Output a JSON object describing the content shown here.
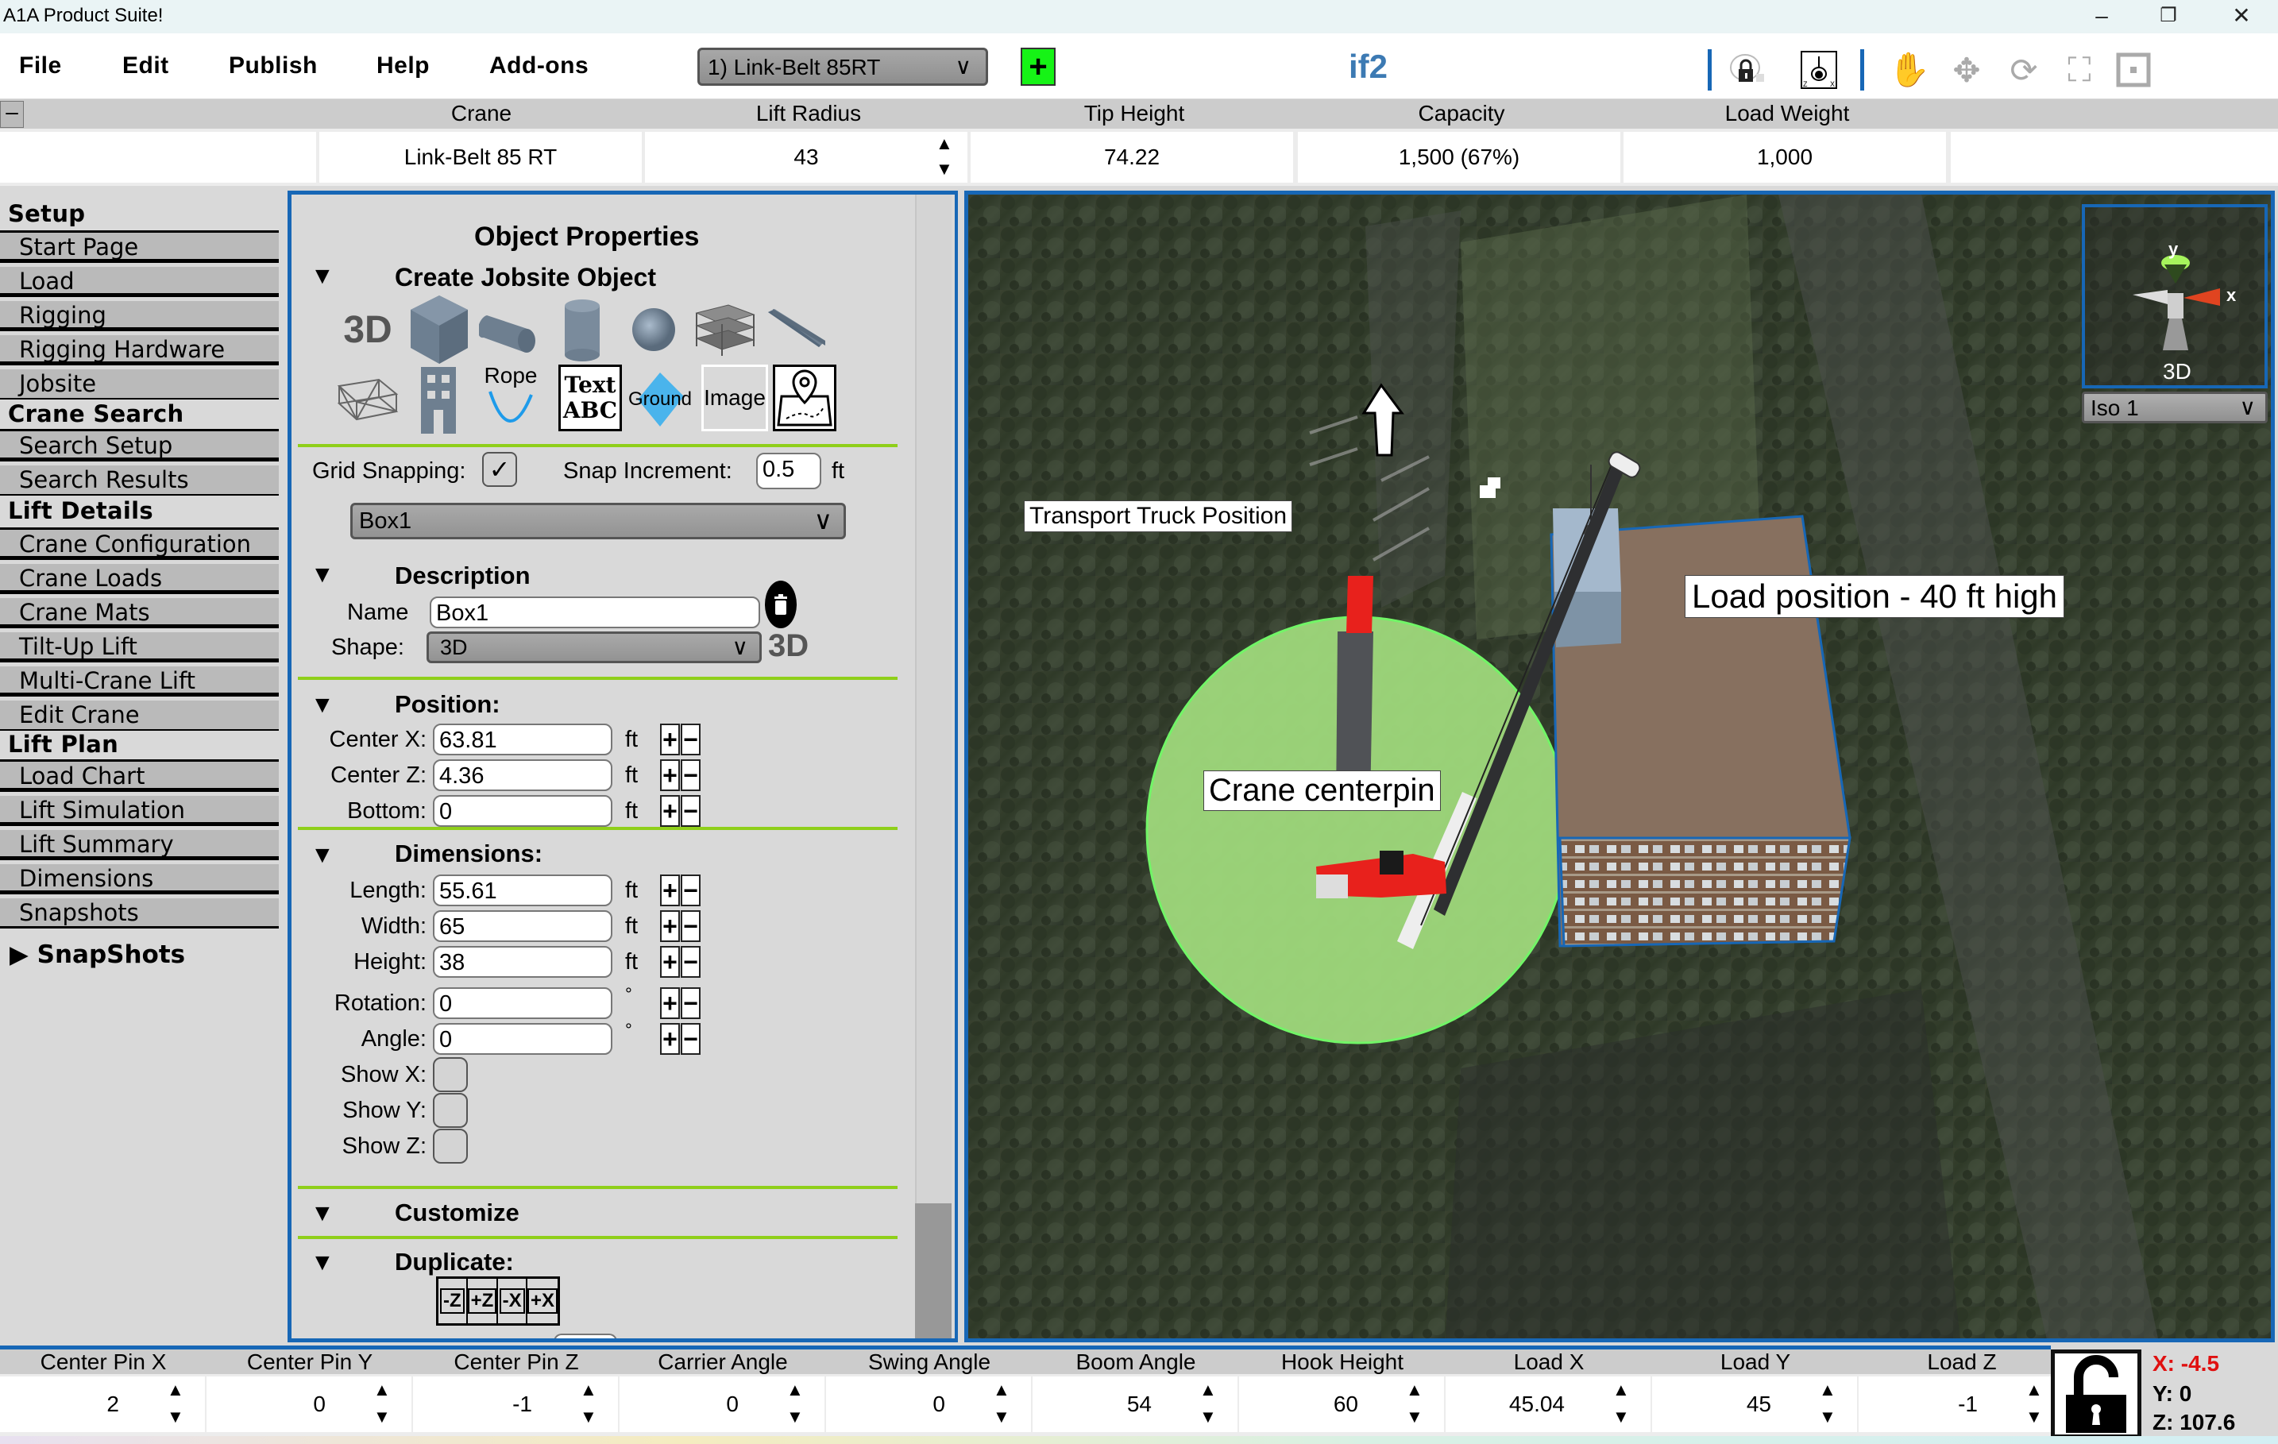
{
  "window": {
    "title": "A1A Product Suite!",
    "controls": [
      "minimize",
      "restore",
      "close"
    ]
  },
  "menubar": {
    "items": [
      "File",
      "Edit",
      "Publish",
      "Help",
      "Add-ons"
    ],
    "crane_select": "1) Link-Belt 85RT",
    "add_crane_label": "+",
    "document_name": "if2",
    "toolbar_icons": [
      "camera-lock-icon",
      "view-axes-icon",
      "pan-hand-icon",
      "move-icon",
      "rotate-icon",
      "fit-view-icon",
      "frame-icon"
    ]
  },
  "crane_info": {
    "collapse_label": "–",
    "headers": [
      "Crane",
      "Lift Radius",
      "Tip Height",
      "Capacity",
      "Load Weight"
    ],
    "values": [
      "Link-Belt 85 RT",
      "43",
      "74.22",
      "1,500 (67%)",
      "1,000"
    ]
  },
  "sidebar": {
    "sections": [
      {
        "title": "Setup",
        "items": [
          "Start Page",
          "Load",
          "Rigging",
          "Rigging Hardware",
          "Jobsite"
        ]
      },
      {
        "title": "Crane Search",
        "items": [
          "Search Setup",
          "Search Results"
        ]
      },
      {
        "title": "Lift Details",
        "items": [
          "Crane Configuration",
          "Crane Loads",
          "Crane Mats",
          "Tilt-Up Lift",
          "Multi-Crane Lift",
          "Edit Crane"
        ]
      },
      {
        "title": "Lift Plan",
        "items": [
          "Load Chart",
          "Lift Simulation",
          "Lift Summary",
          "Dimensions",
          "Snapshots"
        ]
      }
    ],
    "snapshots_toggle": "SnapShots"
  },
  "properties": {
    "title": "Object Properties",
    "create_section": "Create Jobsite Object",
    "object_types_row1": [
      "3D",
      "Box",
      "Horizontal Cylinder",
      "Vertical Cylinder",
      "Sphere",
      "Scaffold",
      "I-Beam"
    ],
    "object_types_row2": [
      "Truss",
      "Building",
      "Rope",
      "Text ABC",
      "Ground",
      "Image",
      "Map Marker"
    ],
    "rope_label": "Rope",
    "text_label_1": "Text",
    "text_label_2": "ABC",
    "ground_label": "Ground",
    "image_label": "Image",
    "grid_snapping_label": "Grid Snapping:",
    "grid_snapping_checked": true,
    "check_mark": "✓",
    "snap_increment_label": "Snap Increment:",
    "snap_increment_value": "0.5",
    "unit_ft": "ft",
    "unit_deg": "°",
    "object_select": "Box1",
    "description_section": "Description",
    "name_label": "Name",
    "name_value": "Box1",
    "shape_label": "Shape:",
    "shape_value": "3D",
    "shape_badge": "3D",
    "position_section": "Position:",
    "position_fields": [
      {
        "label": "Center X:",
        "value": "63.81",
        "unit": "ft"
      },
      {
        "label": "Center Z:",
        "value": "4.36",
        "unit": "ft"
      },
      {
        "label": "Bottom:",
        "value": "0",
        "unit": "ft"
      }
    ],
    "dimensions_section": "Dimensions:",
    "dimension_fields": [
      {
        "label": "Length:",
        "value": "55.61",
        "unit": "ft"
      },
      {
        "label": "Width:",
        "value": "65",
        "unit": "ft"
      },
      {
        "label": "Height:",
        "value": "38",
        "unit": "ft"
      }
    ],
    "rotation_fields": [
      {
        "label": "Rotation:",
        "value": "0",
        "unit": "°"
      },
      {
        "label": "Angle:",
        "value": "0",
        "unit": "°"
      }
    ],
    "show_axes": [
      {
        "label": "Show X:",
        "checked": false
      },
      {
        "label": "Show Y:",
        "checked": false
      },
      {
        "label": "Show Z:",
        "checked": false
      }
    ],
    "customize_section": "Customize",
    "duplicate_section": "Duplicate:",
    "duplicate_buttons": [
      "-Z",
      "+Z",
      "-X",
      "+X"
    ],
    "plus": "+",
    "minus": "−"
  },
  "view3d": {
    "labels": {
      "transport_truck": "Transport Truck Position",
      "load_position": "Load position - 40 ft high",
      "crane_centerpin": "Crane centerpin"
    },
    "gizmo_label": "3D",
    "gizmo_axes": [
      "y",
      "x"
    ],
    "view_select": "Iso 1"
  },
  "bottom": {
    "headers": [
      "Center Pin X",
      "Center Pin Y",
      "Center Pin Z",
      "Carrier Angle",
      "Swing Angle",
      "Boom Angle",
      "Hook Height",
      "Load X",
      "Load Y",
      "Load Z"
    ],
    "values": [
      "2",
      "0",
      "-1",
      "0",
      "0",
      "54",
      "60",
      "45.04",
      "45",
      "-1"
    ],
    "coords": {
      "x": "X: -4.5",
      "y": "Y: 0",
      "z": "Z: 107.6"
    },
    "coord_x_color": "#e01010"
  },
  "colors": {
    "accent_blue": "#1767b6",
    "section_line": "#8fcf1a",
    "add_button": "#16f316",
    "doc_name": "#3c7ab3"
  }
}
